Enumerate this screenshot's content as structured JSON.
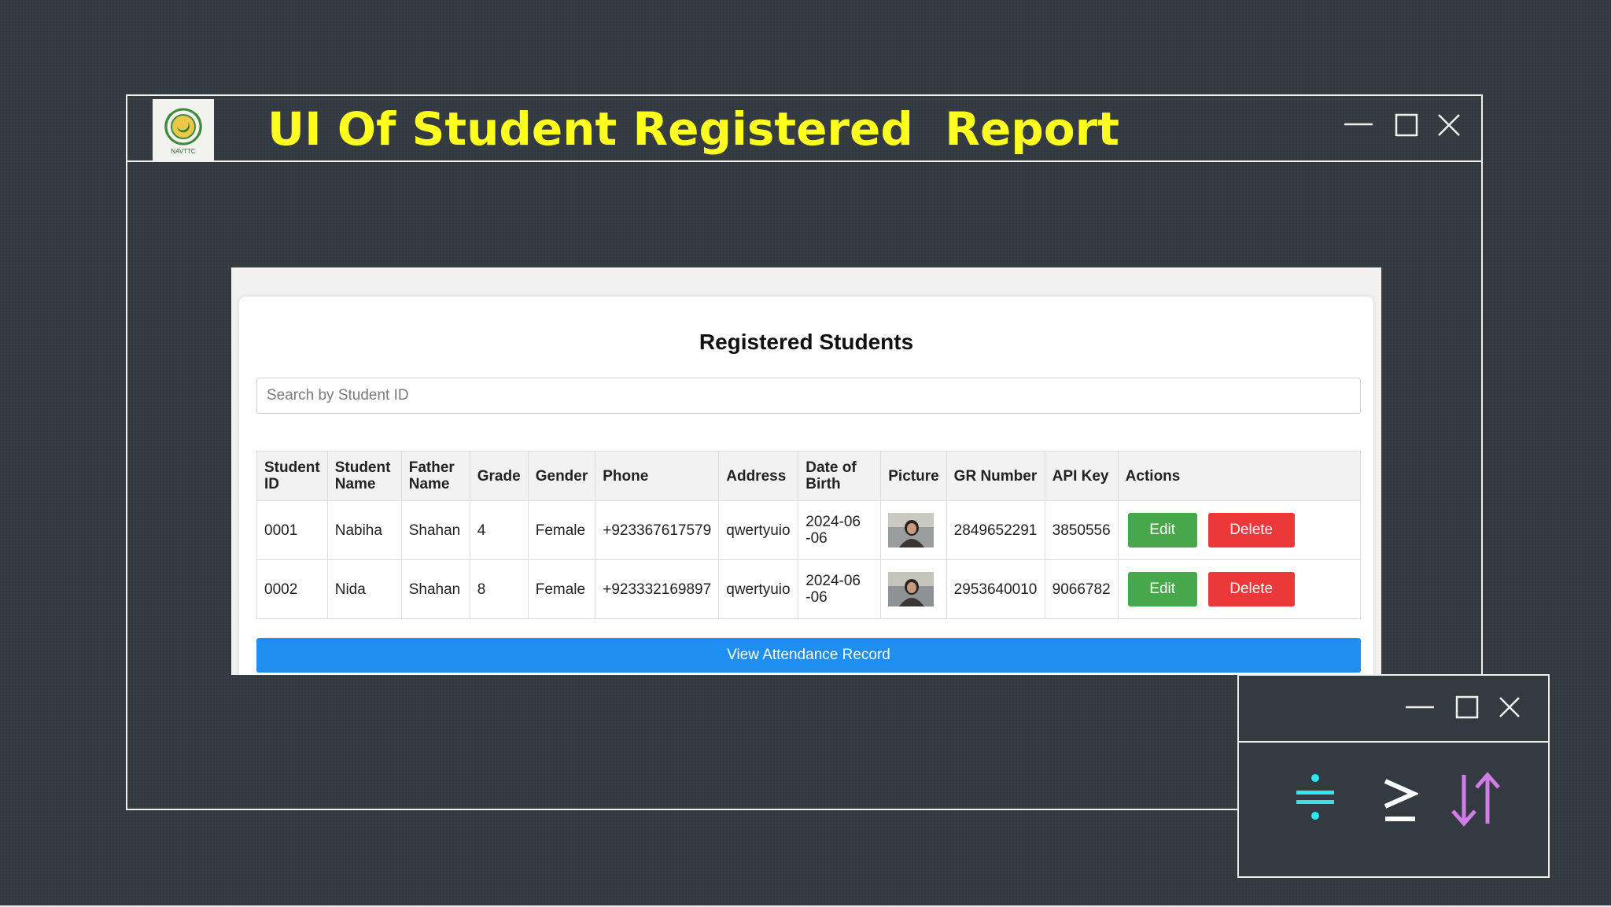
{
  "slide": {
    "title": "UI Of Student Registered  Report",
    "logo_text": "NAVTTC",
    "logo_icon": "navttc-emblem-icon",
    "title_color": "#ffff1f"
  },
  "window_controls": [
    "minimize-icon",
    "maximize-icon",
    "close-icon"
  ],
  "app": {
    "heading": "Registered Students",
    "search": {
      "placeholder": "Search by Student ID",
      "value": ""
    },
    "table": {
      "columns": [
        "Student ID",
        "Student Name",
        "Father Name",
        "Grade",
        "Gender",
        "Phone",
        "Address",
        "Date of Birth",
        "Picture",
        "GR Number",
        "API Key",
        "Actions"
      ],
      "rows": [
        {
          "student_id": "0001",
          "student_name": "Nabiha",
          "father_name": "Shahan",
          "grade": "4",
          "gender": "Female",
          "phone": "+923367617579",
          "address": "qwertyuio",
          "dob": "2024-06-06",
          "gr_number": "2849652291",
          "api_key": "3850556",
          "edit_label": "Edit",
          "delete_label": "Delete"
        },
        {
          "student_id": "0002",
          "student_name": "Nida",
          "father_name": "Shahan",
          "grade": "8",
          "gender": "Female",
          "phone": "+923332169897",
          "address": "qwertyuio",
          "dob": "2024-06-06",
          "gr_number": "2953640010",
          "api_key": "9066782",
          "edit_label": "Edit",
          "delete_label": "Delete"
        }
      ]
    },
    "attendance_button": "View Attendance Record",
    "colors": {
      "edit": "#47a84b",
      "delete": "#ec3838",
      "primary": "#1e8ff0"
    }
  },
  "mini_window": {
    "glyphs": [
      {
        "icon": "divide-icon",
        "char": "÷",
        "color": "#2ee6f0"
      },
      {
        "icon": "greater-equal-icon",
        "char": "≥",
        "color": "#ffffff"
      },
      {
        "icon": "sort-arrows-icon",
        "char": "⇅",
        "color": "#d27ce8"
      }
    ]
  }
}
